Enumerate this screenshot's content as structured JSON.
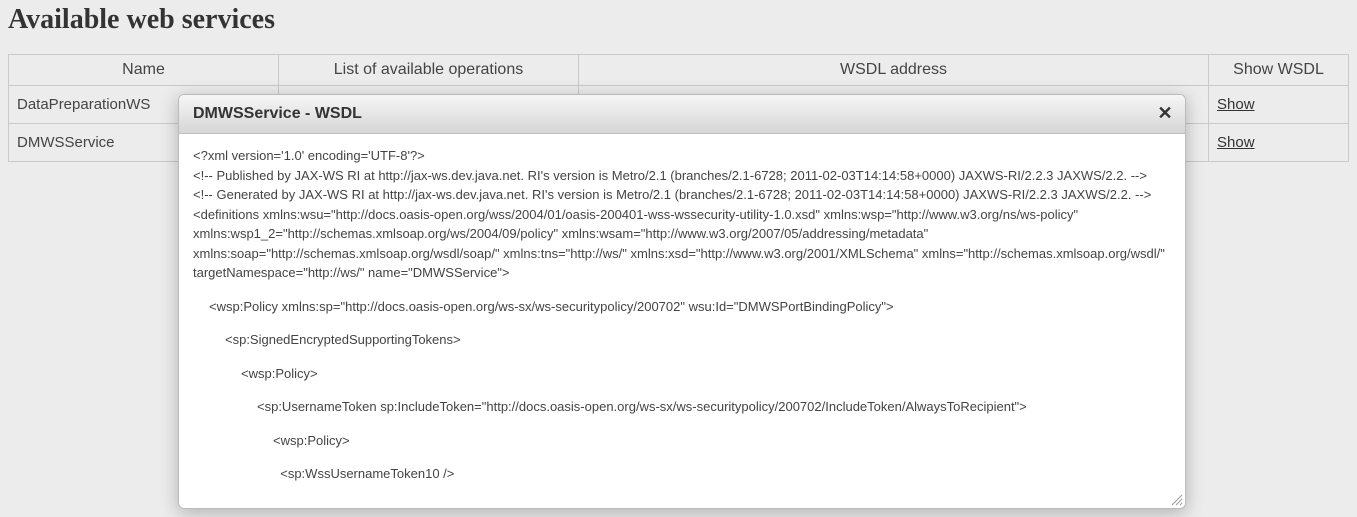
{
  "page": {
    "title": "Available web services"
  },
  "table": {
    "headers": {
      "name": "Name",
      "ops": "List of available operations",
      "addr": "WSDL address",
      "show": "Show WSDL"
    },
    "rows": [
      {
        "name": "DataPreparationWS",
        "show": "Show"
      },
      {
        "name": "DMWSService",
        "show": "Show"
      }
    ]
  },
  "dialog": {
    "title": "DMWSService - WSDL",
    "close_label": "✕",
    "wsdl_lines": [
      {
        "indent": 0,
        "text": "<?xml version='1.0' encoding='UTF-8'?>"
      },
      {
        "indent": 0,
        "text": "<!-- Published by JAX-WS RI at http://jax-ws.dev.java.net. RI's version is Metro/2.1 (branches/2.1-6728; 2011-02-03T14:14:58+0000) JAXWS-RI/2.2.3 JAXWS/2.2. -->"
      },
      {
        "indent": 0,
        "text": "<!-- Generated by JAX-WS RI at http://jax-ws.dev.java.net. RI's version is Metro/2.1 (branches/2.1-6728; 2011-02-03T14:14:58+0000) JAXWS-RI/2.2.3 JAXWS/2.2. -->"
      },
      {
        "indent": 0,
        "text": "<definitions xmlns:wsu=\"http://docs.oasis-open.org/wss/2004/01/oasis-200401-wss-wssecurity-utility-1.0.xsd\" xmlns:wsp=\"http://www.w3.org/ns/ws-policy\" xmlns:wsp1_2=\"http://schemas.xmlsoap.org/ws/2004/09/policy\" xmlns:wsam=\"http://www.w3.org/2007/05/addressing/metadata\" xmlns:soap=\"http://schemas.xmlsoap.org/wsdl/soap/\" xmlns:tns=\"http://ws/\" xmlns:xsd=\"http://www.w3.org/2001/XMLSchema\" xmlns=\"http://schemas.xmlsoap.org/wsdl/\" targetNamespace=\"http://ws/\" name=\"DMWSService\">"
      },
      {
        "blank": true
      },
      {
        "indent": 1,
        "text": "<wsp:Policy xmlns:sp=\"http://docs.oasis-open.org/ws-sx/ws-securitypolicy/200702\" wsu:Id=\"DMWSPortBindingPolicy\">"
      },
      {
        "blank": true
      },
      {
        "indent": 2,
        "text": "<sp:SignedEncryptedSupportingTokens>"
      },
      {
        "blank": true
      },
      {
        "indent": 3,
        "text": "<wsp:Policy>"
      },
      {
        "blank": true
      },
      {
        "indent": 4,
        "text": "<sp:UsernameToken sp:IncludeToken=\"http://docs.oasis-open.org/ws-sx/ws-securitypolicy/200702/IncludeToken/AlwaysToRecipient\">"
      },
      {
        "blank": true
      },
      {
        "indent": 5,
        "text": "<wsp:Policy>"
      },
      {
        "blank": true
      },
      {
        "indent": 5,
        "text": "  <sp:WssUsernameToken10 />"
      }
    ]
  }
}
